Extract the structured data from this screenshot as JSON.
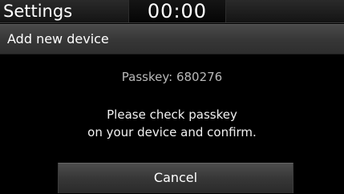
{
  "status_bar": {
    "title": "Settings",
    "clock": "00:00"
  },
  "header": {
    "title": "Add new device"
  },
  "dialog": {
    "passkey_text": "Passkey: 680276",
    "message_line1": "Please check passkey",
    "message_line2": "on your device and confirm.",
    "cancel_label": "Cancel"
  },
  "colors": {
    "background": "#000000",
    "header_bar": "#3a3a3a",
    "passkey_text": "#b9b9b9",
    "button": "#373737"
  }
}
